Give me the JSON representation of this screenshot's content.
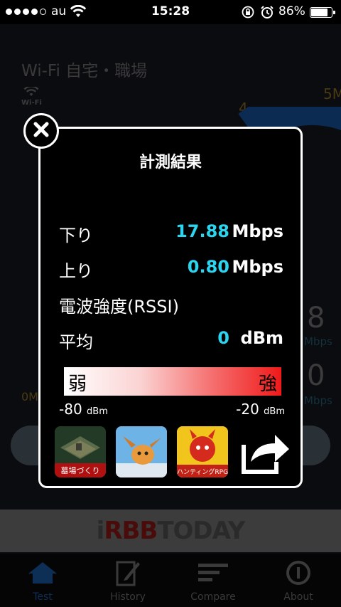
{
  "status_bar": {
    "signal_dots": 5,
    "signal_filled": 4,
    "carrier": "au",
    "time": "15:28",
    "battery_percent": "86%",
    "battery_level": 0.86
  },
  "background": {
    "network_name": "Wi-Fi 自宅・職場",
    "wifi_badge": "Wi-Fi",
    "gauge_labels": [
      "4",
      "5M"
    ],
    "zero_label": "0M",
    "download_partial": "8",
    "download_unit": "Mbps",
    "upload_partial": "0",
    "upload_unit": "Mbps",
    "banner_logo_prefix": "i",
    "banner_logo_red": "RBB",
    "banner_logo_suffix": "TODAY"
  },
  "tabs": [
    {
      "label": "Test",
      "icon": "house-icon",
      "active": true
    },
    {
      "label": "History",
      "icon": "notepad-icon",
      "active": false
    },
    {
      "label": "Compare",
      "icon": "bars-icon",
      "active": false
    },
    {
      "label": "About",
      "icon": "info-icon",
      "active": false
    }
  ],
  "modal": {
    "title": "計測結果",
    "download": {
      "label": "下り",
      "value": "17.88",
      "unit": "Mbps"
    },
    "upload": {
      "label": "上り",
      "value": "0.80",
      "unit": "Mbps"
    },
    "rssi_label": "電波強度(RSSI)",
    "average": {
      "label": "平均",
      "value": "0",
      "unit": "dBm"
    },
    "meter": {
      "weak": "弱",
      "strong": "強"
    },
    "scale_min": "-80",
    "scale_max": "-20",
    "scale_unit": "dBm",
    "apps": [
      {
        "name": "墓場づくり",
        "icon": "graveyard-game-icon"
      },
      {
        "name": "",
        "icon": "dragon-game-icon"
      },
      {
        "name": "ハンティングRPG",
        "icon": "devil-rpg-icon"
      }
    ],
    "share_icon": "share-arrow-icon"
  },
  "colors": {
    "value_cyan": "#2bd5f0",
    "meter_weak": "#ffffff",
    "meter_strong": "#ef1a1a"
  }
}
